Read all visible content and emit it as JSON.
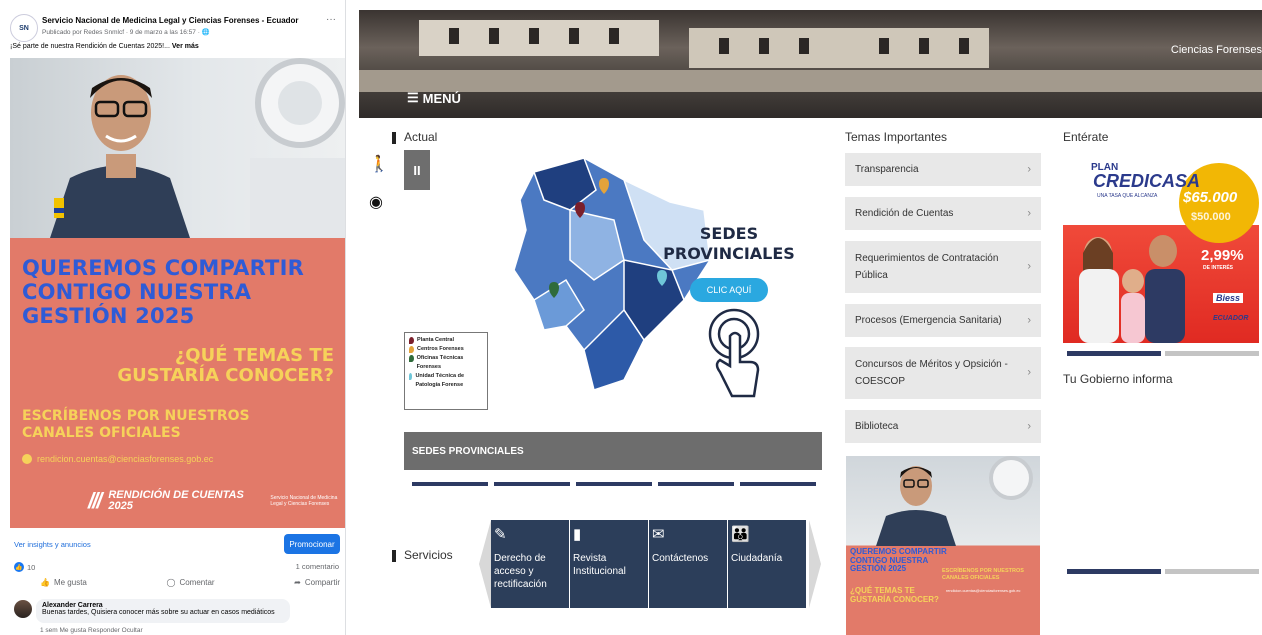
{
  "facebook": {
    "page_name": "Servicio Nacional de Medicina Legal y Ciencias Forenses - Ecuador",
    "meta": "Publicado por Redes Snmlcf · 9 de marzo a las 16:57 · ",
    "more": "···",
    "caption": "¡Sé parte de nuestra Rendición de Cuentas 2025!...",
    "see_more": "Ver más",
    "graphic": {
      "headline": "QUEREMOS COMPARTIR CONTIGO NUESTRA GESTIÓN 2025",
      "question": "¿QUÉ TEMAS TE GUSTARÍA CONOCER?",
      "write_us": "ESCRÍBENOS POR NUESTROS CANALES OFICIALES",
      "email": "rendicion.cuentas@cienciasforenses.gob.ec",
      "logo_text": "RENDICIÓN DE CUENTAS 2025",
      "logo_inst": "Servicio Nacional de Medicina Legal y Ciencias Forenses"
    },
    "insights": "Ver insights y anuncios",
    "promote": "Promocionar",
    "likes_count": "10",
    "comments_count": "1 comentario",
    "actions": {
      "like": "Me gusta",
      "comment": "Comentar",
      "share": "Compartir"
    },
    "comment": {
      "author": "Alexander Carrera",
      "text": "Buenas tardes, Quisiera conocer más sobre su actuar en casos mediáticos",
      "meta": "1 sem   Me gusta   Responder   Ocultar"
    }
  },
  "site": {
    "brand": "Ciencias Forenses",
    "menu": "MENÚ",
    "actual_title": "Actual",
    "map": {
      "title": "SEDES PROVINCIALES",
      "button": "CLIC AQUÍ",
      "legend": [
        "Planta Central",
        "Centros Forenses",
        "Oficinas Técnicas Forenses",
        "Unidad Técnica de Patología Forense"
      ],
      "legend_colors": [
        "#7a1f2b",
        "#e3a33a",
        "#2f6b3a",
        "#6ec6d8"
      ]
    },
    "sedes_bar": "SEDES PROVINCIALES",
    "services_title": "Servicios",
    "services": [
      {
        "icon": "edit-icon",
        "label": "Derecho de acceso y rectificación"
      },
      {
        "icon": "book-icon",
        "label": "Revista Institucional"
      },
      {
        "icon": "mail-icon",
        "label": "Contáctenos"
      },
      {
        "icon": "people-icon",
        "label": "Ciudadanía"
      }
    ],
    "temas_title": "Temas Importantes",
    "temas": [
      "Transparencia",
      "Rendición de Cuentas",
      "Requerimientos de Contratación Pública",
      "Procesos (Emergencia Sanitaria)",
      "Concursos de Méritos y Opsición - COESCOP",
      "Biblioteca"
    ],
    "promo_small": {
      "headline": "QUEREMOS COMPARTIR CONTIGO NUESTRA GESTIÓN 2025",
      "question": "¿QUÉ TEMAS TE GUSTARÍA CONOCER?",
      "write_us": "ESCRÍBENOS POR NUESTROS CANALES OFICIALES",
      "contacts": "rendicion.cuentas@cienciasforenses.gob.ec"
    },
    "enterate_title": "Entérate",
    "credicasa": {
      "plan": "PLAN",
      "name": "CREDICASA",
      "tagline": "UNA TASA QUE ALCANZA",
      "amount": "$65.000",
      "old_amount": "$50.000",
      "rate": "2,99%",
      "rate_label": "DE INTERÉS",
      "biess": "Biess",
      "ecuador": "ECUADOR"
    },
    "gobierno": "Tu Gobierno informa",
    "colors": {
      "navy": "#2d3a63",
      "tile": "#2c3e5a",
      "grey": "#6d6d6d",
      "coral": "#e27a69"
    }
  }
}
